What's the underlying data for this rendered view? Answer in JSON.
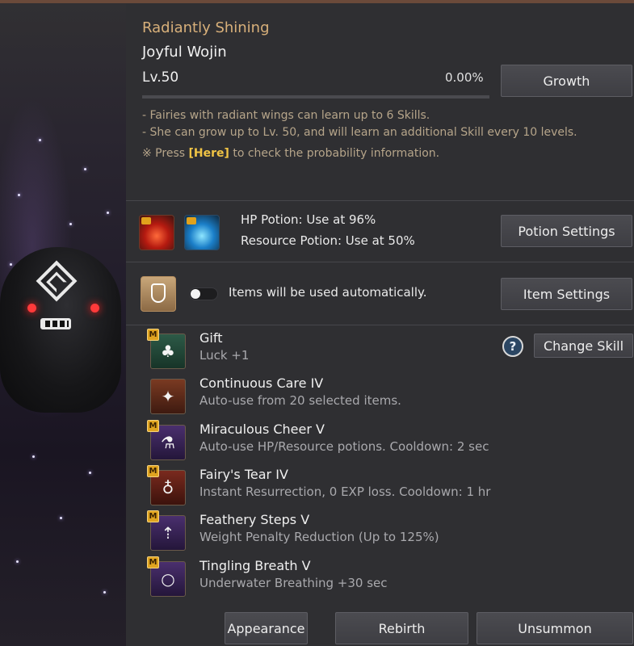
{
  "pet": {
    "rank": "Radiantly Shining",
    "name": "Joyful Wojin",
    "level": "Lv.50",
    "exp_percent": "0.00%",
    "exp_fraction": 0.0
  },
  "buttons": {
    "growth": "Growth",
    "potion_settings": "Potion Settings",
    "item_settings": "Item Settings",
    "change_skill": "Change Skill",
    "appearance": "Appearance",
    "rebirth": "Rebirth",
    "unsummon": "Unsummon"
  },
  "info": {
    "line1": "- Fairies with radiant wings can learn up to 6 Skills.",
    "line2": "- She can grow up to Lv. 50, and will learn an additional Skill every 10 levels.",
    "line3_prefix": "※ Press ",
    "line3_link": "[Here]",
    "line3_suffix": " to check the probability information."
  },
  "potions": {
    "hp": "HP Potion: Use at 96%",
    "resource": "Resource Potion: Use at 50%"
  },
  "items": {
    "auto_text": "Items will be used automatically.",
    "toggle_on": false
  },
  "help_symbol": "?",
  "skills": [
    {
      "badge": "M",
      "name": "Gift",
      "desc": "Luck +1",
      "icon": "clover-icon"
    },
    {
      "badge": "",
      "name": "Continuous Care IV",
      "desc": "Auto-use from 20 selected items.",
      "icon": "fairy-icon"
    },
    {
      "badge": "M",
      "name": "Miraculous Cheer V",
      "desc": "Auto-use HP/Resource potions. Cooldown: 2 sec",
      "icon": "potions-icon"
    },
    {
      "badge": "M",
      "name": "Fairy's Tear IV",
      "desc": "Instant Resurrection, 0 EXP loss. Cooldown: 1 hr",
      "icon": "tear-icon"
    },
    {
      "badge": "M",
      "name": "Feathery Steps V",
      "desc": "Weight Penalty Reduction (Up to 125%)",
      "icon": "weight-icon"
    },
    {
      "badge": "M",
      "name": "Tingling Breath V",
      "desc": "Underwater Breathing +30 sec",
      "icon": "bubble-icon"
    }
  ]
}
